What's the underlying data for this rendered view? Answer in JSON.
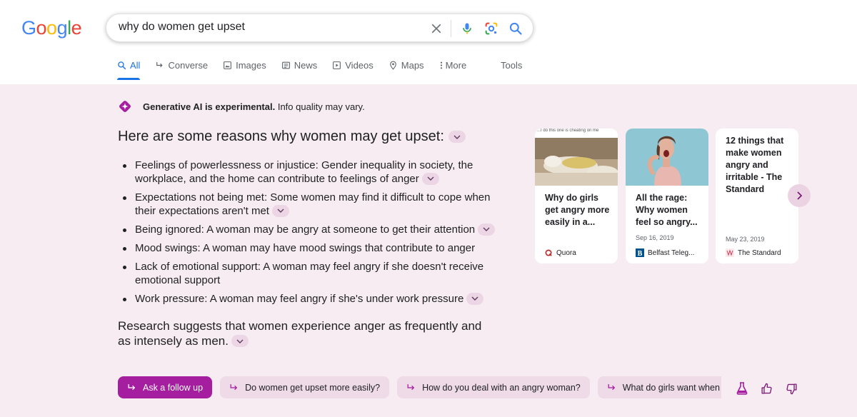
{
  "logo": [
    "G",
    "o",
    "o",
    "g",
    "l",
    "e"
  ],
  "logo_colors": [
    "#4285f4",
    "#ea4335",
    "#fbbc05",
    "#4285f4",
    "#34a853",
    "#ea4335"
  ],
  "search": {
    "query": "why do women get upset"
  },
  "tabs": [
    {
      "label": "All",
      "icon": "search-icon"
    },
    {
      "label": "Converse",
      "icon": "arrow-return-icon"
    },
    {
      "label": "Images",
      "icon": "image-icon"
    },
    {
      "label": "News",
      "icon": "news-icon"
    },
    {
      "label": "Videos",
      "icon": "play-icon"
    },
    {
      "label": "Maps",
      "icon": "map-pin-icon"
    },
    {
      "label": "More",
      "icon": "dots-vertical-icon"
    }
  ],
  "tools_label": "Tools",
  "sge": {
    "notice_bold": "Generative AI is experimental.",
    "notice_rest": " Info quality may vary.",
    "heading": "Here are some reasons why women may get upset:",
    "bullets": [
      {
        "text": "Feelings of powerlessness or injustice: Gender inequality in society, the workplace, and the home can contribute to feelings of anger",
        "expandable": true
      },
      {
        "text": "Expectations not being met: Some women may find it difficult to cope when their expectations aren't met",
        "expandable": true
      },
      {
        "text": "Being ignored: A woman may be angry at someone to get their attention",
        "expandable": true
      },
      {
        "text": "Mood swings: A woman may have mood swings that contribute to anger",
        "expandable": false
      },
      {
        "text": "Lack of emotional support: A woman may feel angry if she doesn't receive emotional support",
        "expandable": false
      },
      {
        "text": "Work pressure: A woman may feel angry if she's under work pressure",
        "expandable": true
      }
    ],
    "research": "Research suggests that women experience anger as frequently and as intensely as men.",
    "cards": [
      {
        "title": "Why do girls get angry more easily in a...",
        "date": "",
        "source": "Quora",
        "thumb_caption": "...I do this one is cheating on me"
      },
      {
        "title": "All the rage: Why women feel so angry...",
        "date": "Sep 16, 2019",
        "source": "Belfast Teleg..."
      },
      {
        "title": "12 things that make women angry and irritable - The Standard",
        "date": "May 23, 2019",
        "source": "The Standard"
      }
    ],
    "followups": [
      {
        "label": "Ask a follow up",
        "primary": true
      },
      {
        "label": "Do women get upset more easily?",
        "primary": false
      },
      {
        "label": "How do you deal with an angry woman?",
        "primary": false
      },
      {
        "label": "What do girls want when they are angry?",
        "primary": false
      }
    ]
  },
  "colors": {
    "sge_background": "#f7ecf1",
    "accent_purple": "#a51ea0",
    "chip_background": "#efdbe8",
    "active_tab_blue": "#1a73e8"
  }
}
